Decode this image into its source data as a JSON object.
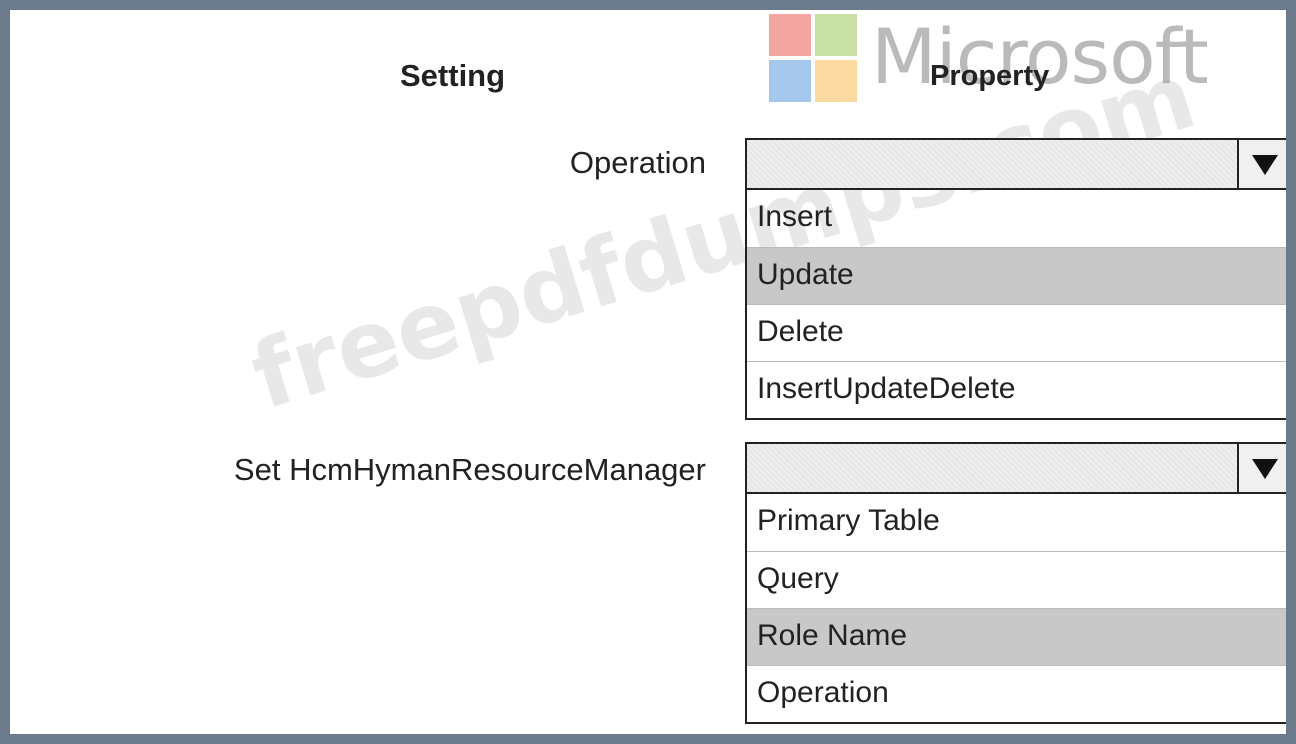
{
  "watermark": {
    "logo_text": "Microsoft",
    "site_text": "freepdfdumps.com"
  },
  "headers": {
    "setting": "Setting",
    "property": "Property"
  },
  "rows": [
    {
      "label": "Operation",
      "options": [
        "Insert",
        "Update",
        "Delete",
        "InsertUpdateDelete"
      ],
      "highlighted": "Update"
    },
    {
      "label": "Set HcmHymanResourceManager",
      "options": [
        "Primary Table",
        "Query",
        "Role Name",
        "Operation"
      ],
      "highlighted": "Role Name"
    }
  ],
  "icons": {
    "dropdown": "triangle-down-icon"
  },
  "colors": {
    "frame": "#6b7b8c",
    "highlight": "#c8c8c8"
  }
}
